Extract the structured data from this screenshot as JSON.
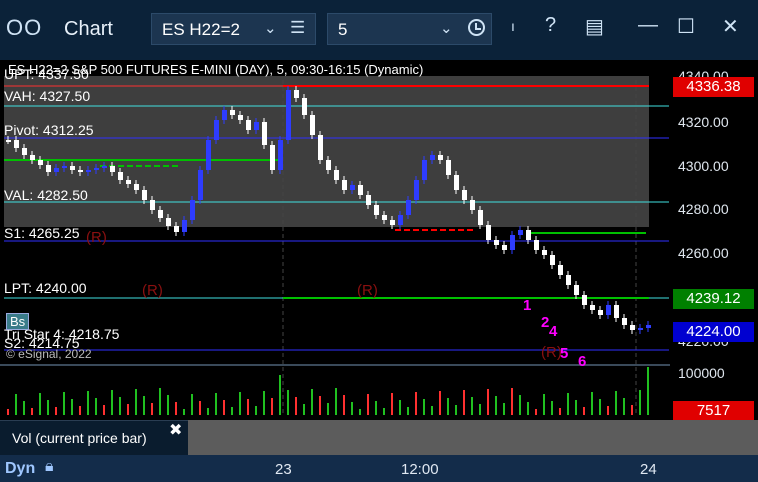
{
  "window": {
    "title": "Chart",
    "symbol": "ES H22=2",
    "interval": "5"
  },
  "chart": {
    "header": "ES H22=2 S&P 500 FUTURES E-MINI (DAY), 5, 09:30-16:15 (Dynamic)",
    "copyright": "© eSignal, 2022",
    "levels": {
      "upt": "UPT: 4337.50",
      "vah": "VAH: 4327.50",
      "pivot": "Pivot: 4312.25",
      "val": "VAL: 4282.50",
      "s1": "S1: 4265.25",
      "lpt": "LPT: 4240.00",
      "tri_star": "Tri Star 4: 4218.75",
      "s2": "S2: 4214.75"
    },
    "price_axis": [
      "4340.00",
      "4320.00",
      "4300.00",
      "4280.00",
      "4260.00",
      "4220.00"
    ],
    "price_tags": {
      "high": "4336.38",
      "mid": "4239.12",
      "last": "4224.00"
    },
    "volume_axis": "100000",
    "volume_tag": "7517",
    "r_markers": [
      "(R)",
      "(R)",
      "(R)",
      "(R)"
    ],
    "seq_labels": [
      "1",
      "2",
      "4",
      "5",
      "6"
    ],
    "b_label": "Bs",
    "colors": {
      "up": "#2e3cff",
      "down": "#ffffff",
      "red_tag": "#e00000",
      "green_tag": "#008000",
      "blue_tag": "#0000d0",
      "magenta": "#ff00ff"
    }
  },
  "time_axis": [
    "23",
    "12:00",
    "24"
  ],
  "volume_tooltip": "Vol (current price bar)",
  "bottom": {
    "mode": "Dyn"
  }
}
